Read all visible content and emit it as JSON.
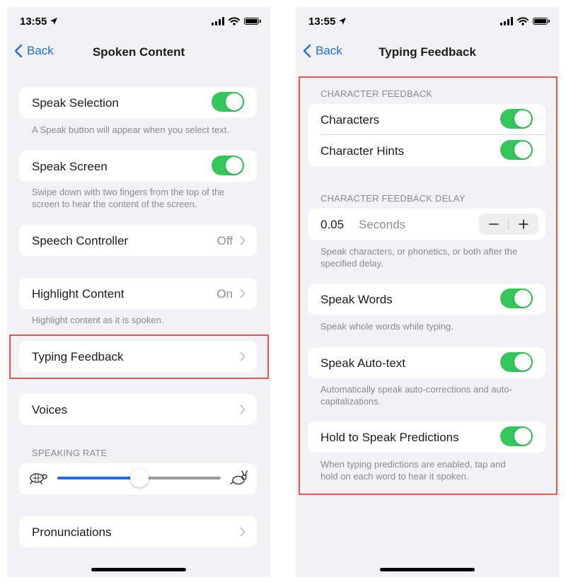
{
  "left_screen": {
    "status_bar": {
      "time": "13:55"
    },
    "nav": {
      "back_label": "Back",
      "title": "Spoken Content"
    },
    "speak_selection": {
      "label": "Speak Selection",
      "toggle_on": true,
      "footer": "A Speak button will appear when you select text."
    },
    "speak_screen": {
      "label": "Speak Screen",
      "toggle_on": true,
      "footer_line1": "Swipe down with two fingers from the top of the",
      "footer_line2": "screen to hear the content of the screen."
    },
    "speech_controller": {
      "label": "Speech Controller",
      "value": "Off"
    },
    "highlight_content": {
      "label": "Highlight Content",
      "value": "On",
      "footer": "Highlight content as it is spoken."
    },
    "typing_feedback": {
      "label": "Typing Feedback"
    },
    "voices": {
      "label": "Voices"
    },
    "speaking_rate": {
      "header": "SPEAKING RATE",
      "value_fraction": 0.5
    },
    "pronunciations": {
      "label": "Pronunciations"
    }
  },
  "right_screen": {
    "status_bar": {
      "time": "13:55"
    },
    "nav": {
      "back_label": "Back",
      "title": "Typing Feedback"
    },
    "character_feedback": {
      "header": "CHARACTER FEEDBACK",
      "characters": {
        "label": "Characters",
        "toggle_on": true
      },
      "character_hints": {
        "label": "Character Hints",
        "toggle_on": true
      }
    },
    "character_feedback_delay": {
      "header": "CHARACTER FEEDBACK DELAY",
      "value": "0.05",
      "unit": "Seconds",
      "minus_symbol": "−",
      "plus_symbol": "+",
      "footer_line1": "Speak characters, or phonetics, or both after the",
      "footer_line2": "specified delay."
    },
    "speak_words": {
      "label": "Speak Words",
      "toggle_on": true,
      "footer": "Speak whole words while typing."
    },
    "speak_auto_text": {
      "label": "Speak Auto-text",
      "toggle_on": true,
      "footer_line1": "Automatically speak auto-corrections and auto-",
      "footer_line2": "capitalizations."
    },
    "hold_to_speak": {
      "label": "Hold to Speak Predictions",
      "toggle_on": true,
      "footer_line1": "When typing predictions are enabled, tap and",
      "footer_line2": "hold on each word to hear it spoken."
    }
  },
  "colors": {
    "accent_blue": "#1e6fe8",
    "toggle_green": "#34c759",
    "highlight_red": "#e2584a",
    "background_gray": "#f2f2f6"
  }
}
